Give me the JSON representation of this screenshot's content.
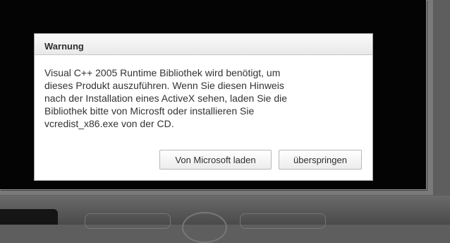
{
  "dialog": {
    "title": "Warnung",
    "message": "Visual C++ 2005 Runtime Bibliothek wird benötigt, um\ndieses Produkt auszuführen. Wenn Sie diesen Hinweis\nnach der Installation eines ActiveX sehen, laden Sie die\nBibliothek bitte von Microsft oder installieren Sie\nvcredist_x86.exe von der CD.",
    "buttons": {
      "download_label": "Von Microsoft laden",
      "skip_label": "überspringen"
    }
  },
  "colors": {
    "backdrop": "#040404",
    "dialog_background": "#ffffff",
    "header_gradient_top": "#fafafa",
    "header_gradient_bottom": "#e9e9e9"
  }
}
